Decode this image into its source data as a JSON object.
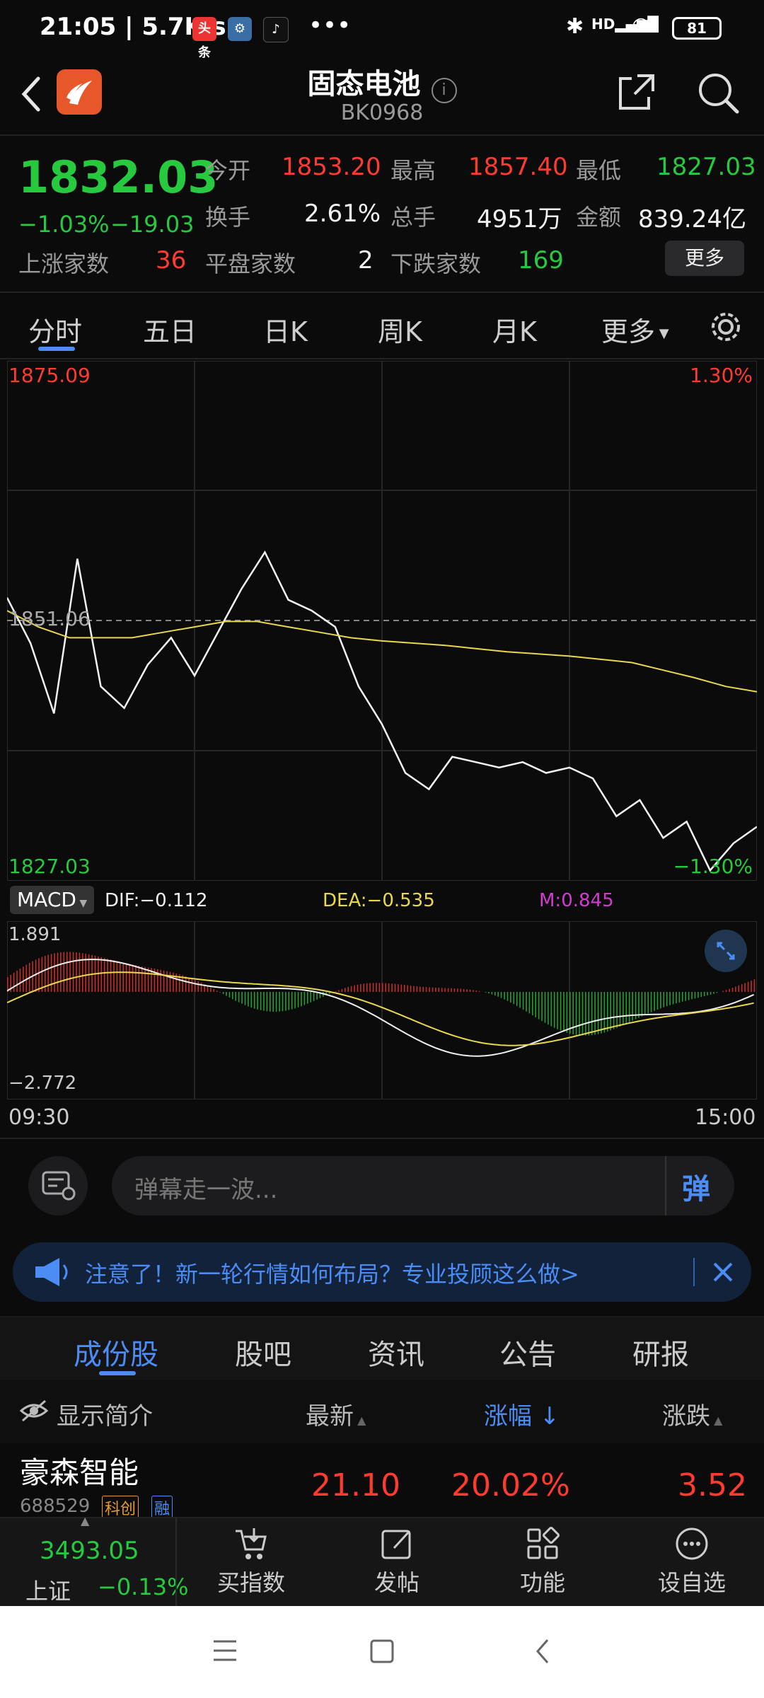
{
  "status_bar": {
    "time": "21:05 | 5.7K/s",
    "app_badge_1": "头条",
    "battery": "81",
    "network": "HD"
  },
  "header": {
    "title": "固态电池",
    "code": "BK0968"
  },
  "quote": {
    "price": "1832.03",
    "change_pct": "−1.03%",
    "change_abs": "−19.03",
    "open_label": "今开",
    "open_value": "1853.20",
    "high_label": "最高",
    "high_value": "1857.40",
    "low_label": "最低",
    "low_value": "1827.03",
    "turnover_label": "换手",
    "turnover_value": "2.61%",
    "volume_label": "总手",
    "volume_value": "4951万",
    "amount_label": "金额",
    "amount_value": "839.24亿",
    "up_label": "上涨家数",
    "up_value": "36",
    "flat_label": "平盘家数",
    "flat_value": "2",
    "down_label": "下跌家数",
    "down_value": "169",
    "more_button": "更多"
  },
  "period_tabs": [
    "分时",
    "五日",
    "日K",
    "周K",
    "月K",
    "更多"
  ],
  "chart": {
    "top_price": "1875.09",
    "top_pct": "1.30%",
    "mid_price": "1851.06",
    "bottom_price": "1827.03",
    "bottom_pct": "−1.30%",
    "time_start": "09:30",
    "time_end": "15:00"
  },
  "chart_data": {
    "type": "line",
    "ylim": [
      1827.03,
      1875.09
    ],
    "prev_close": 1851.06,
    "series": [
      {
        "values": [
          1853.2,
          1849.0,
          1842.5,
          1856.8,
          1845.0,
          1843.0,
          1847.0,
          1849.5,
          1846.0,
          1850.0,
          1854.0,
          1857.4,
          1853.0,
          1852.0,
          1850.5,
          1845.0,
          1841.5,
          1837.0,
          1835.5,
          1838.5,
          1838.0,
          1837.5,
          1838.0,
          1837.0,
          1837.5,
          1836.5,
          1833.0,
          1834.5,
          1831.0,
          1832.5,
          1828.0,
          1830.5,
          1832.03
        ]
      },
      {
        "values": [
          1852.0,
          1850.5,
          1849.5,
          1849.5,
          1849.5,
          1850.0,
          1850.5,
          1851.0,
          1851.0,
          1850.5,
          1850.0,
          1849.5,
          1849.2,
          1849.0,
          1848.8,
          1848.5,
          1848.2,
          1848.0,
          1847.8,
          1847.5,
          1847.2,
          1846.5,
          1845.8,
          1845.0,
          1844.5
        ]
      }
    ]
  },
  "macd": {
    "label": "MACD",
    "dif": "DIF:−0.112",
    "dea": "DEA:−0.535",
    "m": "M:0.845",
    "top": "1.891",
    "bottom": "−2.772"
  },
  "danmaku": {
    "placeholder": "弹幕走一波...",
    "send_label": "弹"
  },
  "notice": {
    "text": "注意了！新一轮行情如何布局？专业投顾这么做>"
  },
  "sub_tabs": [
    "成份股",
    "股吧",
    "资讯",
    "公告",
    "研报"
  ],
  "table": {
    "show_intro": "显示简介",
    "col_latest": "最新",
    "col_change_pct": "涨幅",
    "col_change": "涨跌",
    "rows": [
      {
        "name": "豪森智能",
        "code": "688529",
        "tag1": "科创",
        "tag2": "融",
        "latest": "21.10",
        "change_pct": "20.02%",
        "change": "3.52"
      }
    ]
  },
  "bottom_bar": {
    "index_value": "3493.05",
    "index_name": "上证",
    "index_change": "−0.13%",
    "items": [
      "买指数",
      "发帖",
      "功能",
      "设自选"
    ]
  },
  "colors": {
    "up": "#ff3b30",
    "down": "#27c93f",
    "accent": "#4b8cf5",
    "avg_line": "#e8d84a"
  }
}
